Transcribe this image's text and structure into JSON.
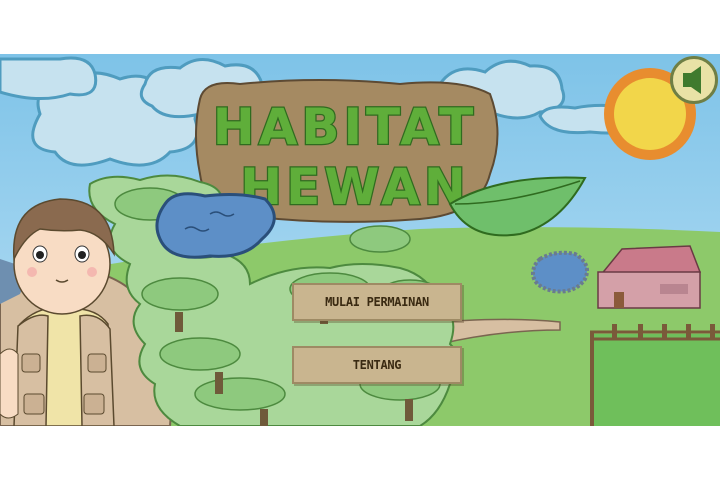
{
  "game": {
    "title_line1": "HABITAT",
    "title_line2": "HEWAN"
  },
  "menu": {
    "start_label": "MULAI PERMAINAN",
    "about_label": "TENTANG"
  },
  "controls": {
    "sound_icon": "speaker-icon"
  },
  "colors": {
    "sky": "#8fcbeb",
    "grass": "#8dc96a",
    "title_fill": "#5fae3a",
    "button": "#c9b58f",
    "sun": "#f2d64a"
  }
}
